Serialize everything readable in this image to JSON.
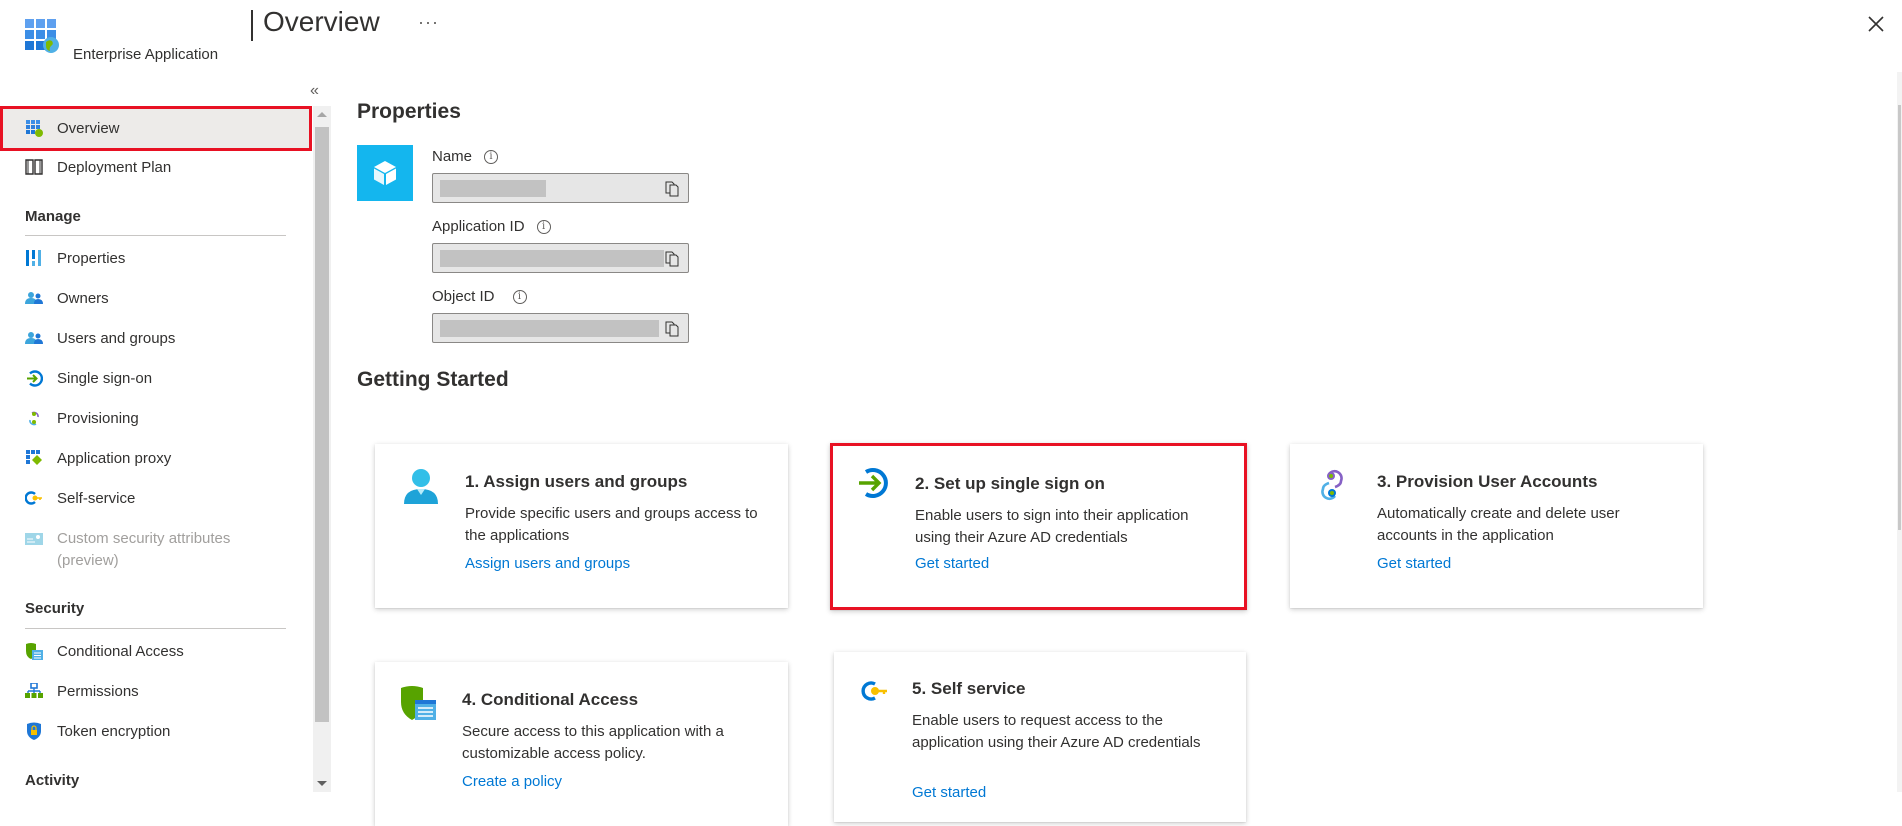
{
  "header": {
    "title": "Overview",
    "subtitle": "Enterprise Application",
    "more_label": "···",
    "collapse_label": "«",
    "icons": {
      "app": "enterprise-app-icon",
      "close": "close-icon",
      "more": "more-options-icon"
    }
  },
  "sidebar": {
    "items": [
      {
        "label": "Overview",
        "icon": "overview-icon",
        "selected": true
      },
      {
        "label": "Deployment Plan",
        "icon": "book-icon"
      }
    ],
    "sections": [
      {
        "heading": "Manage",
        "items": [
          {
            "label": "Properties",
            "icon": "properties-icon"
          },
          {
            "label": "Owners",
            "icon": "owners-icon"
          },
          {
            "label": "Users and groups",
            "icon": "users-groups-icon"
          },
          {
            "label": "Single sign-on",
            "icon": "single-sign-on-icon"
          },
          {
            "label": "Provisioning",
            "icon": "provisioning-icon"
          },
          {
            "label": "Application proxy",
            "icon": "application-proxy-icon"
          },
          {
            "label": "Self-service",
            "icon": "self-service-icon"
          },
          {
            "label": "Custom security attributes",
            "label2": "(preview)",
            "icon": "custom-security-attributes-icon",
            "disabled": true
          }
        ]
      },
      {
        "heading": "Security",
        "items": [
          {
            "label": "Conditional Access",
            "icon": "conditional-access-icon"
          },
          {
            "label": "Permissions",
            "icon": "permissions-icon"
          },
          {
            "label": "Token encryption",
            "icon": "token-encryption-icon"
          }
        ]
      },
      {
        "heading": "Activity",
        "items": []
      }
    ]
  },
  "properties": {
    "heading": "Properties",
    "fields": [
      {
        "label": "Name",
        "value": "[redacted]"
      },
      {
        "label": "Application ID",
        "value": "[redacted]"
      },
      {
        "label": "Object ID",
        "value": "[redacted]"
      }
    ],
    "info_glyph": "i"
  },
  "getting_started": {
    "heading": "Getting Started",
    "cards": [
      {
        "title": "1. Assign users and groups",
        "description": "Provide specific users and groups access to the applications",
        "link": "Assign users and groups",
        "icon": "user-icon"
      },
      {
        "title": "2. Set up single sign on",
        "description": "Enable users to sign into their application using their Azure AD credentials",
        "link": "Get started",
        "icon": "single-sign-on-icon",
        "highlighted": true
      },
      {
        "title": "3. Provision User Accounts",
        "description": "Automatically create and delete user accounts in the application",
        "link": "Get started",
        "icon": "provisioning-icon"
      },
      {
        "title": "4. Conditional Access",
        "description": "Secure access to this application with a customizable access policy.",
        "link": "Create a policy",
        "icon": "conditional-access-icon"
      },
      {
        "title": "5. Self service",
        "description": "Enable users to request access to the application using their Azure AD credentials",
        "link": "Get started",
        "icon": "self-service-icon"
      }
    ]
  },
  "colors": {
    "accent": "#0078d4",
    "highlight_border": "#e81123",
    "selected_bg": "#edebe9",
    "logo_bg": "#14b6ee"
  }
}
